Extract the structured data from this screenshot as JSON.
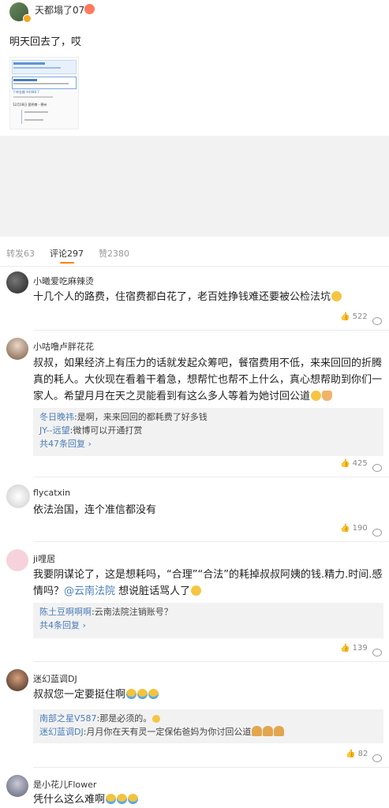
{
  "post": {
    "user": "天都塌了07",
    "text": "明天回去了，哎"
  },
  "tabs": {
    "repost": "转发63",
    "comment": "评论297",
    "like": "赞2380"
  },
  "comments": [
    {
      "user": "小曦爱吃麻辣烫",
      "text": "十几个人的路费，住宿费都白花了，老百姓挣钱难还要被公检法坑",
      "likes": "522"
    },
    {
      "user": "小咕噜卢胖花花",
      "text": "叔叔，如果经济上有压力的话就发起众筹吧，餐宿费用不低，来来回回的折腾真的耗人。大伙现在看着干着急，想帮忙也帮不上什么，真心想帮助到你们一家人。希望月月在天之灵能看到有这么多人等着为她讨回公道",
      "replies": [
        {
          "user": "冬日晚祎",
          "text": ":是啊，来来回回的都耗费了好多钱"
        },
        {
          "user": "JY--远望",
          "text": ":微博可以开通打赏"
        }
      ],
      "more": "共47条回复",
      "likes": "425"
    },
    {
      "user": "flycatxin",
      "text": "依法治国，连个准信都没有",
      "likes": "190"
    },
    {
      "user": "ji哩居",
      "text_a": "我要阴谋论了，这是想耗吗，“合理”“合法”的耗掉叔叔阿姨的钱.精力.时间.感情吗？",
      "mention": "@云南法院",
      "text_b": " 想说脏话骂人了",
      "replies": [
        {
          "user": "陈土豆啊啊啊",
          "text": ":云南法院注销账号？"
        }
      ],
      "more": "共4条回复",
      "likes": "139"
    },
    {
      "user": "迷幻蓝调DJ",
      "text": "叔叔您一定要挺住啊",
      "replies": [
        {
          "user": "南部之星V587",
          "text": ":那是必须的。"
        },
        {
          "user": "迷幻蓝调DJ",
          "text": ":月月你在天有灵一定保佑爸妈为你讨回公道"
        }
      ],
      "likes": "82"
    },
    {
      "user": "是小花儿Flower",
      "text": "凭什么这么难啊"
    }
  ],
  "thumbnail": {
    "line1": "12月18日 昆明南 - 德州",
    "line2": "下单金额 ¥4488.7"
  },
  "colors": {
    "accent": "#4a7db8",
    "tab_active": "#333333",
    "gray_bg": "#f2f2f2"
  }
}
